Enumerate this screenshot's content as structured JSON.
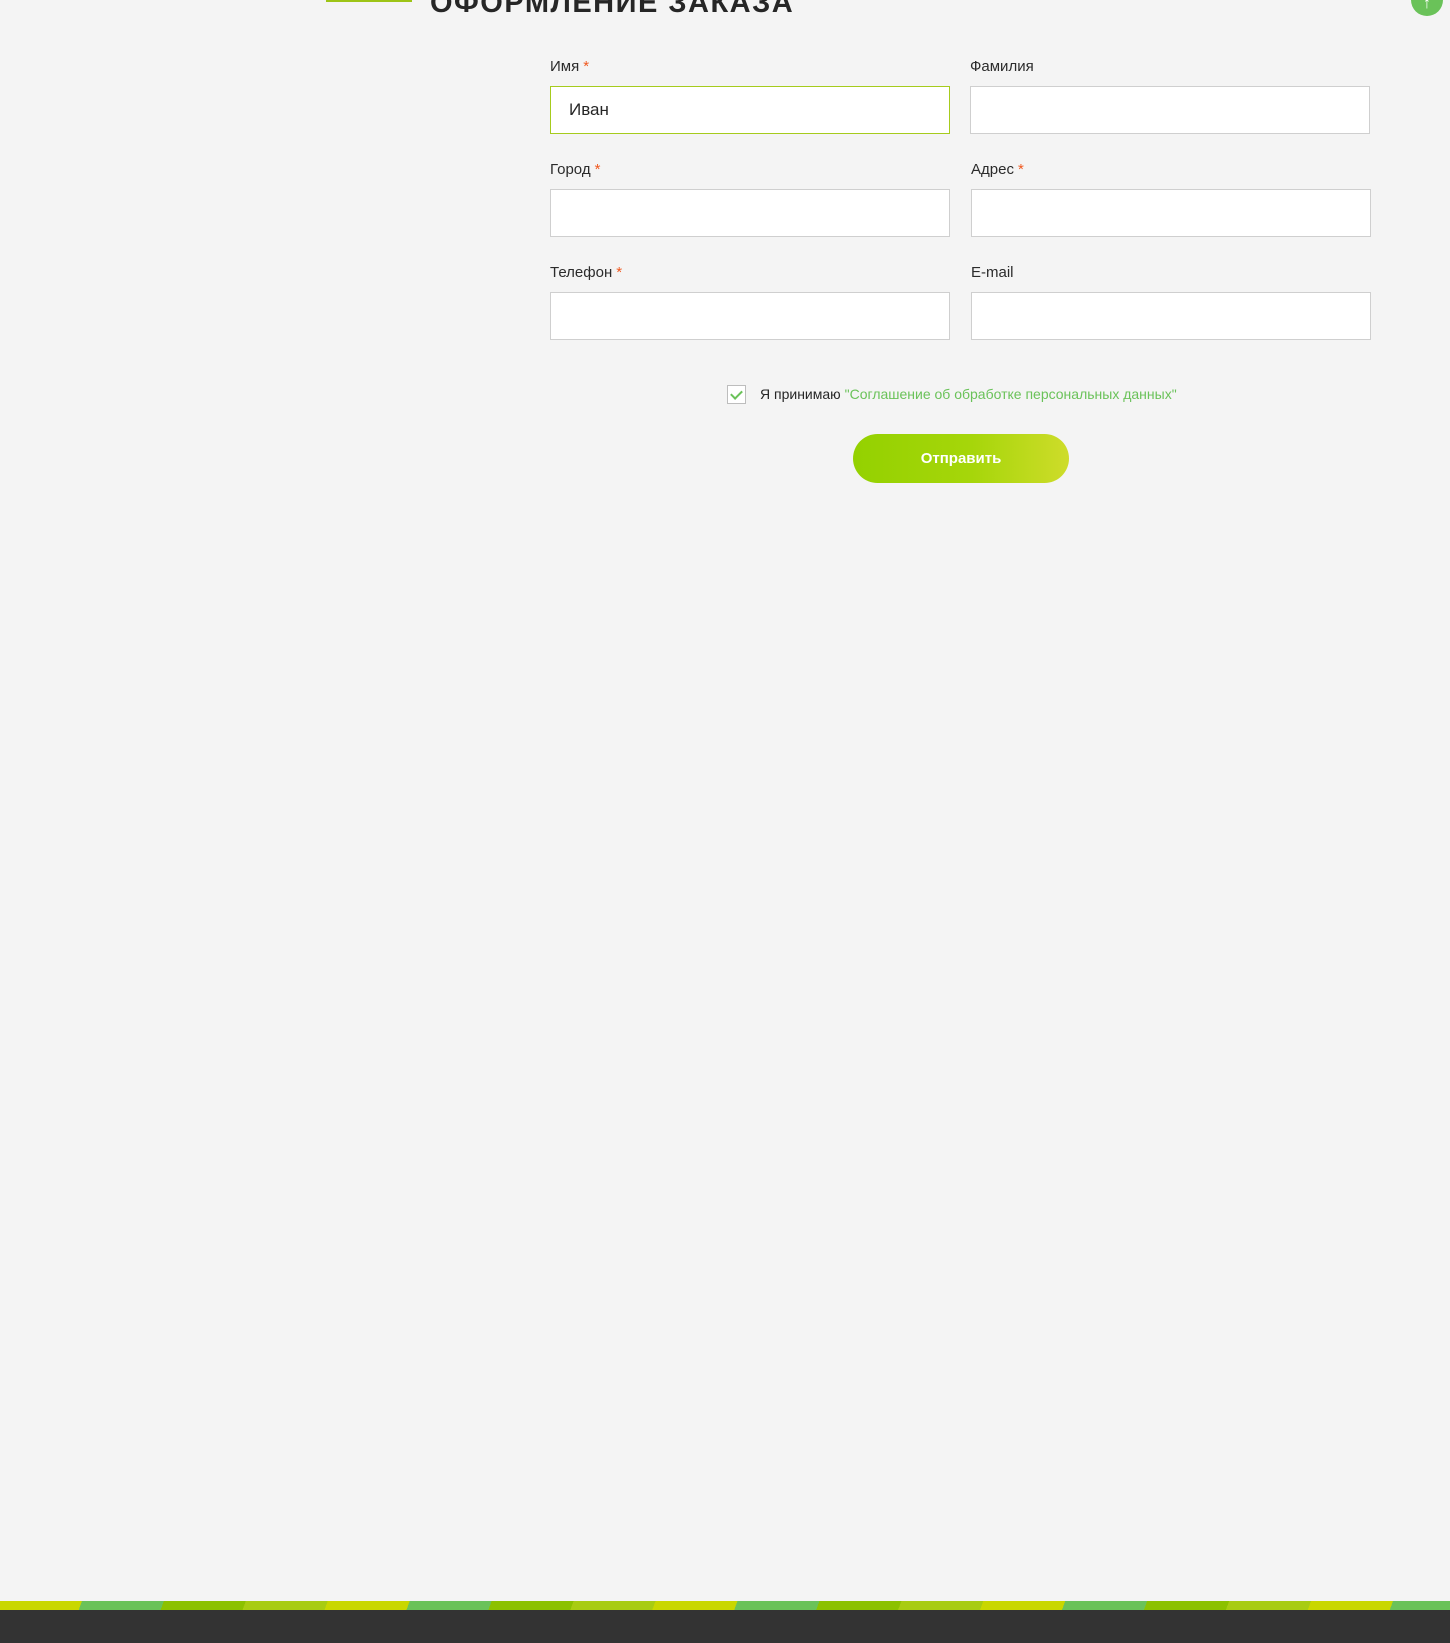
{
  "page": {
    "title": "ОФОРМЛЕНИЕ ЗАКАЗА"
  },
  "scroll_top": {
    "glyph": "↑"
  },
  "form": {
    "required_mark": "*",
    "first_name": {
      "label": "Имя",
      "value": "Иван",
      "required": true
    },
    "last_name": {
      "label": "Фамилия",
      "value": "",
      "required": false
    },
    "city": {
      "label": "Город",
      "value": "",
      "required": true
    },
    "address": {
      "label": "Адрес",
      "value": "",
      "required": true
    },
    "phone": {
      "label": "Телефон",
      "value": "",
      "required": true
    },
    "email": {
      "label": "E-mail",
      "value": "",
      "required": false
    },
    "consent": {
      "checked": true,
      "text": "Я принимаю",
      "link": "\"Соглашение об обработке персональных данных\""
    },
    "submit_label": "Отправить"
  },
  "colors": {
    "accent_green": "#6ac259",
    "lime": "#9dc416",
    "required": "#f0581e",
    "footer": "#333333"
  }
}
